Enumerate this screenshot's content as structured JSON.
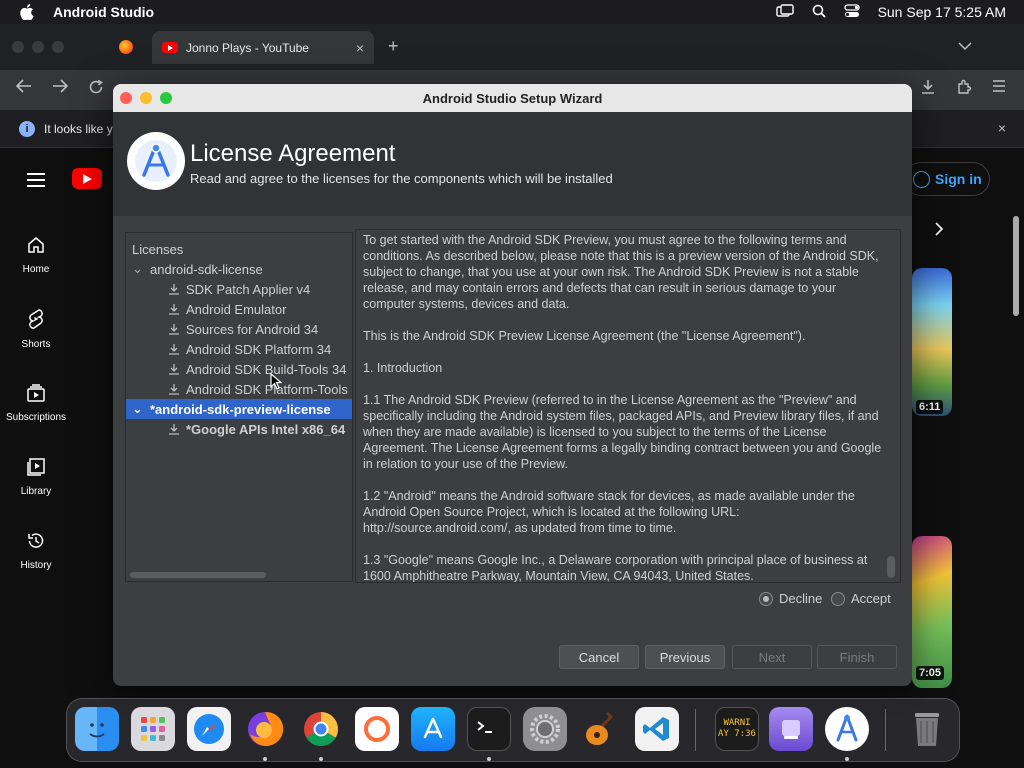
{
  "menubar": {
    "app_name": "Android Studio",
    "clock": "Sun Sep 17  5:25 AM"
  },
  "browser": {
    "tab_title": "Jonno Plays - YouTube",
    "tab_close": "×",
    "new_tab": "+",
    "infobar_text": "It looks like y",
    "infobar_close": "×"
  },
  "youtube": {
    "sign_in": "Sign in",
    "nav": [
      {
        "label": "Home",
        "icon": "home-icon"
      },
      {
        "label": "Shorts",
        "icon": "shorts-icon"
      },
      {
        "label": "Subscriptions",
        "icon": "subscriptions-icon"
      },
      {
        "label": "Library",
        "icon": "library-icon"
      },
      {
        "label": "History",
        "icon": "history-icon"
      }
    ],
    "durations": [
      "6:11",
      "7:05"
    ]
  },
  "dialog": {
    "window_title": "Android Studio Setup Wizard",
    "header_title": "License Agreement",
    "header_subtitle": "Read and agree to the licenses for the components which will be installed",
    "tree": {
      "root": "Licenses",
      "items": [
        {
          "label": "android-sdk-license",
          "level": 1,
          "expand": "⌄"
        },
        {
          "label": "SDK Patch Applier v4",
          "level": 2
        },
        {
          "label": "Android Emulator",
          "level": 2
        },
        {
          "label": "Sources for Android 34",
          "level": 2
        },
        {
          "label": "Android SDK Platform 34",
          "level": 2
        },
        {
          "label": "Android SDK Build-Tools 34",
          "level": 2
        },
        {
          "label": "Android SDK Platform-Tools",
          "level": 2
        },
        {
          "label": "*android-sdk-preview-license",
          "level": 1,
          "expand": "⌄",
          "selected": true
        },
        {
          "label": "*Google APIs Intel x86_64",
          "level": 2
        }
      ]
    },
    "license_paragraphs": [
      "To get started with the Android SDK Preview, you must agree to the following terms and conditions. As described below, please note that this is a preview version of the Android SDK, subject to change, that you use at your own risk. The Android SDK Preview is not a stable release, and may contain errors and defects that can result in serious damage to your computer systems, devices and data.",
      "This is the Android SDK Preview License Agreement (the \"License Agreement\").",
      "1. Introduction",
      "1.1 The Android SDK Preview (referred to in the License Agreement as the \"Preview\" and specifically including the Android system files, packaged APIs, and Preview library files, if and when they are made available) is licensed to you subject to the terms of the License Agreement. The License Agreement forms a legally binding contract between you and Google in relation to your use of the Preview.",
      "1.2 \"Android\" means the Android software stack for devices, as made available under the Android Open Source Project, which is located at the following URL: http://source.android.com/, as updated from time to time.",
      "1.3 \"Google\" means Google Inc., a Delaware corporation with principal place of business at 1600 Amphitheatre Parkway, Mountain View, CA 94043, United States."
    ],
    "radio": {
      "decline": "Decline",
      "accept": "Accept",
      "selected": "decline"
    },
    "buttons": {
      "cancel": "Cancel",
      "previous": "Previous",
      "next": "Next",
      "finish": "Finish"
    }
  },
  "dock": {
    "apps": [
      "Finder",
      "Launchpad",
      "Safari",
      "Firefox",
      "Chrome",
      "Postman",
      "App Store",
      "Terminal",
      "System Settings",
      "GarageBand",
      "VS Code",
      "Console",
      "Podman",
      "Android Studio",
      "Trash"
    ],
    "console_text": "WARNI\nAY 7:36"
  },
  "colors": {
    "selection": "#2f65ca",
    "youtube_red": "#ff0000",
    "link_blue": "#3ea6ff",
    "dialog_bg": "#3c3f41"
  }
}
